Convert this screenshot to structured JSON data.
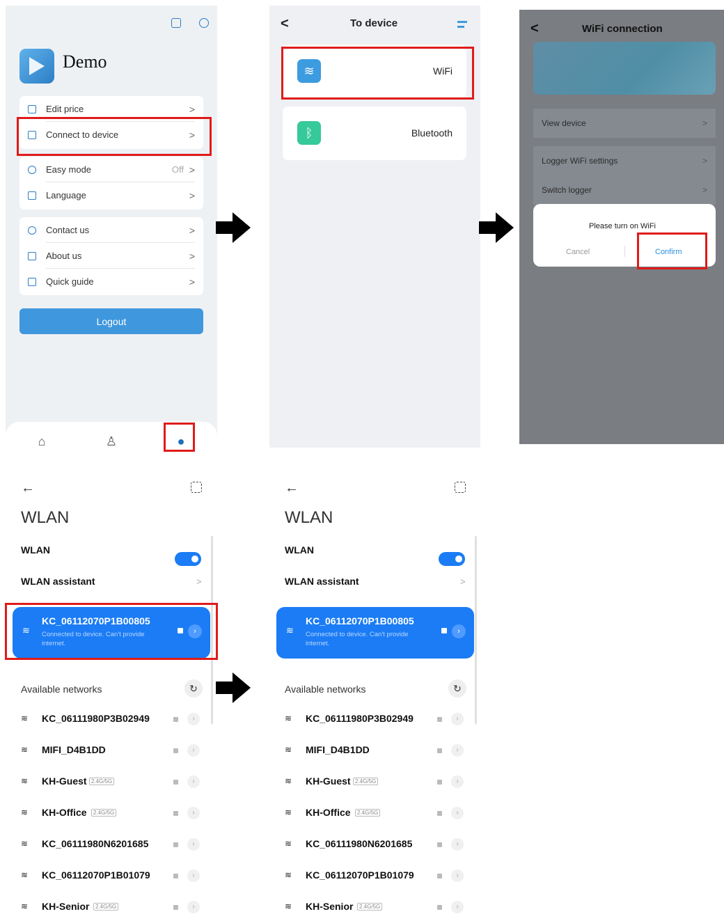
{
  "screen1": {
    "app_name": "Demo",
    "menu_group1": [
      {
        "label": "Edit price"
      },
      {
        "label": "Connect to device"
      }
    ],
    "menu_group2": [
      {
        "label": "Easy mode",
        "value": "Off"
      },
      {
        "label": "Language"
      }
    ],
    "menu_group3": [
      {
        "label": "Contact us"
      },
      {
        "label": "About us"
      },
      {
        "label": "Quick guide"
      }
    ],
    "chevron": ">",
    "logout_label": "Logout"
  },
  "screen2": {
    "title": "To device",
    "back": "<",
    "options": [
      {
        "label": "WiFi",
        "color": "#3d9be0"
      },
      {
        "label": "Bluetooth",
        "color": "#36c99a"
      }
    ]
  },
  "screen3": {
    "title": "WiFi connection",
    "back": "<",
    "rows": [
      {
        "label": "View device"
      },
      {
        "label": "Logger WiFi settings"
      },
      {
        "label": "Switch logger"
      }
    ],
    "dialog": {
      "message": "Please turn on WiFi",
      "cancel": "Cancel",
      "confirm": "Confirm"
    }
  },
  "wlan": {
    "back": "←",
    "title": "WLAN",
    "wlan_label": "WLAN",
    "assistant_label": "WLAN assistant",
    "connected": {
      "ssid": "KC_06112070P1B00805",
      "status": "Connected to device. Can't provide internet."
    },
    "available_label": "Available networks",
    "networks": [
      {
        "name": "KC_06111980P3B02949",
        "tag": ""
      },
      {
        "name": "MIFI_D4B1DD",
        "tag": ""
      },
      {
        "name": "KH-Guest",
        "tag": "2.4G/5G"
      },
      {
        "name": "KH-Office",
        "tag": "2.4G/5G"
      },
      {
        "name": "KC_06111980N6201685",
        "tag": ""
      },
      {
        "name": "KC_06112070P1B01079",
        "tag": ""
      },
      {
        "name": "KH-Senior",
        "tag": "2.4G/5G"
      }
    ]
  },
  "colors": {
    "highlight": "#e01b1b",
    "accent": "#1b7cf5",
    "logout": "#3f97dd"
  }
}
